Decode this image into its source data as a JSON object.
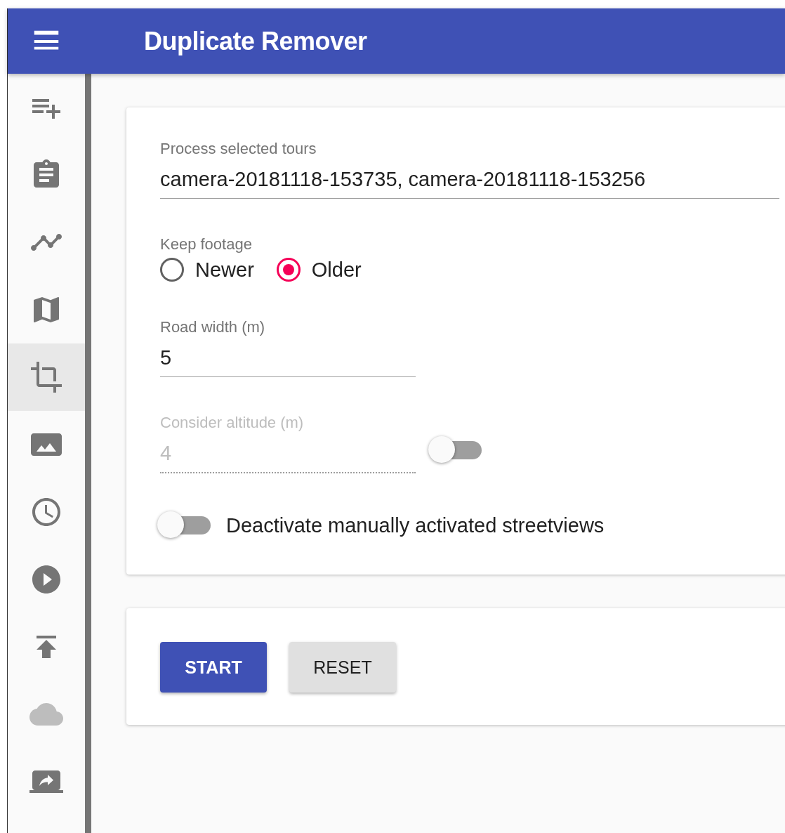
{
  "app_bar": {
    "title": "Duplicate Remover"
  },
  "sidebar": {
    "items": [
      {
        "selected": false,
        "disabled": false
      },
      {
        "selected": false,
        "disabled": false
      },
      {
        "selected": false,
        "disabled": false
      },
      {
        "selected": false,
        "disabled": false
      },
      {
        "selected": true,
        "disabled": false
      },
      {
        "selected": false,
        "disabled": false
      },
      {
        "selected": false,
        "disabled": false
      },
      {
        "selected": false,
        "disabled": false
      },
      {
        "selected": false,
        "disabled": false
      },
      {
        "selected": false,
        "disabled": true
      },
      {
        "selected": false,
        "disabled": false
      }
    ]
  },
  "form": {
    "tours": {
      "label": "Process selected tours",
      "value": "camera-20181118-153735, camera-20181118-153256"
    },
    "keep_footage": {
      "label": "Keep footage",
      "options": [
        {
          "label": "Newer",
          "selected": false
        },
        {
          "label": "Older",
          "selected": true
        }
      ]
    },
    "road_width": {
      "label": "Road width (m)",
      "value": "5"
    },
    "altitude": {
      "label": "Consider altitude (m)",
      "value": "4",
      "disabled": true,
      "toggle_on": false
    },
    "deactivate": {
      "label": "Deactivate manually activated streetviews",
      "on": false
    }
  },
  "actions": [
    {
      "label": "START",
      "kind": "primary"
    },
    {
      "label": "RESET",
      "kind": "secondary"
    }
  ]
}
